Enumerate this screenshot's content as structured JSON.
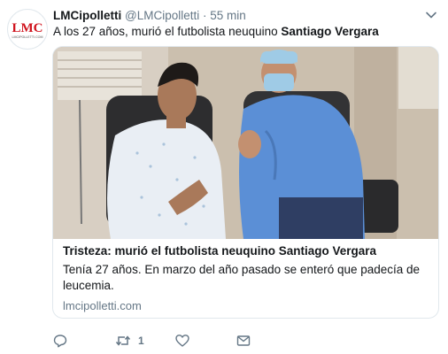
{
  "tweet": {
    "display_name": "LMCipolletti",
    "handle": "@LMCipolletti",
    "separator": "·",
    "time": "55 min",
    "text_prefix": "A los 27 años, murió el futbolista neuquino ",
    "text_bold": "Santiago Vergara"
  },
  "avatar": {
    "logo_text": "LMC",
    "logo_sub": "LMCIPOLLETTI.COM",
    "color": "#d0141e"
  },
  "card": {
    "title": "Tristeza: murió el futbolista neuquino Santiago Vergara",
    "description": "Tenía 27 años. En marzo del año pasado se enteró que padecía de leucemia.",
    "domain": "lmcipolletti.com"
  },
  "actions": {
    "reply_icon": "reply-icon",
    "retweet_icon": "retweet-icon",
    "retweet_count": "1",
    "like_icon": "heart-icon",
    "dm_icon": "envelope-icon"
  },
  "colors": {
    "text": "#14171a",
    "muted": "#657786",
    "border": "#e1e8ed",
    "brand": "#d0141e",
    "gown": "#5b8fd6",
    "mask": "#9fcbe6"
  }
}
